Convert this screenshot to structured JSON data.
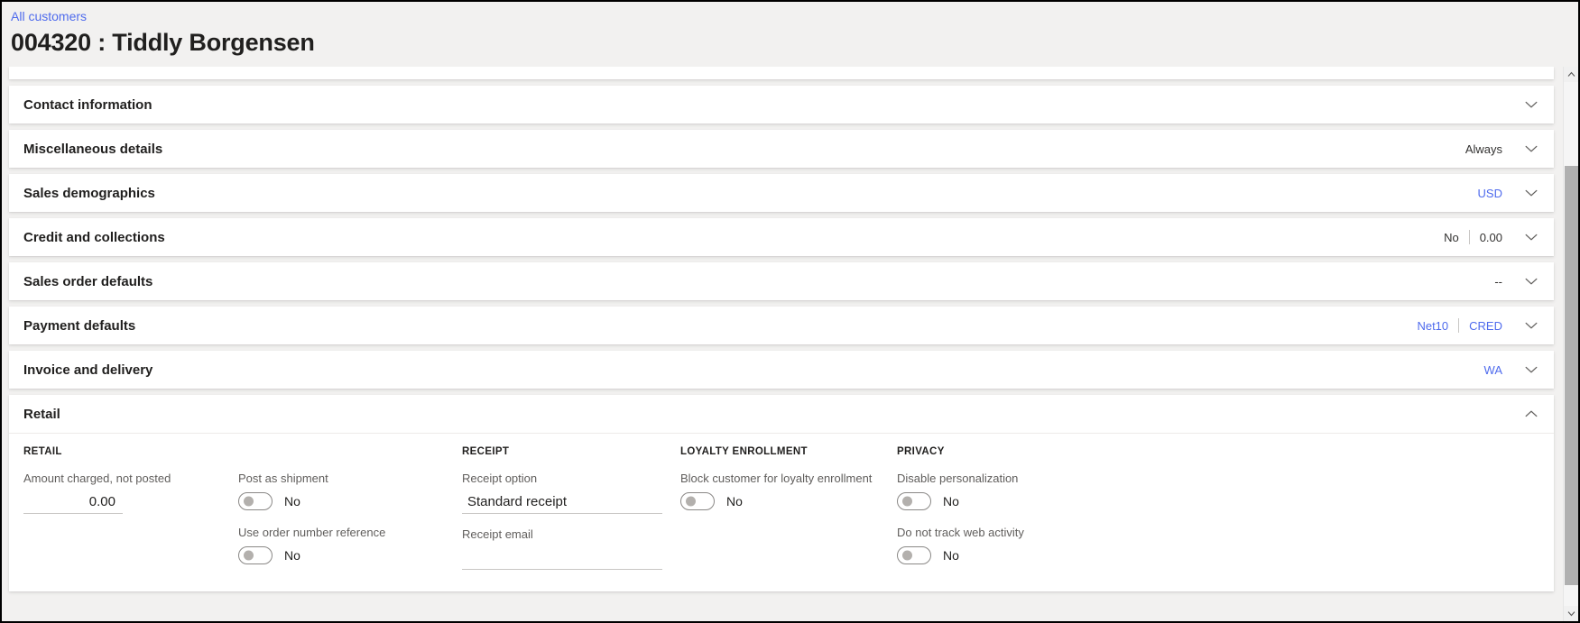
{
  "header": {
    "breadcrumb": "All customers",
    "title": "004320 : Tiddly Borgensen"
  },
  "sections": [
    {
      "title": "Contact information",
      "summary": [],
      "expanded": false
    },
    {
      "title": "Miscellaneous details",
      "summary": [
        {
          "text": "Always",
          "link": false
        }
      ],
      "expanded": false
    },
    {
      "title": "Sales demographics",
      "summary": [
        {
          "text": "USD",
          "link": true
        }
      ],
      "expanded": false
    },
    {
      "title": "Credit and collections",
      "summary": [
        {
          "text": "No",
          "link": false
        },
        {
          "text": "0.00",
          "link": false
        }
      ],
      "expanded": false
    },
    {
      "title": "Sales order defaults",
      "summary": [
        {
          "text": "--",
          "link": false
        }
      ],
      "expanded": false
    },
    {
      "title": "Payment defaults",
      "summary": [
        {
          "text": "Net10",
          "link": true
        },
        {
          "text": "CRED",
          "link": true
        }
      ],
      "expanded": false
    },
    {
      "title": "Invoice and delivery",
      "summary": [
        {
          "text": "WA",
          "link": true
        }
      ],
      "expanded": false
    },
    {
      "title": "Retail",
      "summary": [],
      "expanded": true
    }
  ],
  "retail": {
    "columns": [
      {
        "heading": "RETAIL",
        "fields": [
          {
            "type": "numeric",
            "label": "Amount charged, not posted",
            "value": "0.00",
            "placeholder": ""
          }
        ]
      },
      {
        "heading": "",
        "fields": [
          {
            "type": "toggle",
            "label": "Post as shipment",
            "value": "No"
          },
          {
            "type": "toggle",
            "label": "Use order number reference",
            "value": "No"
          }
        ]
      },
      {
        "heading": "RECEIPT",
        "fields": [
          {
            "type": "text",
            "label": "Receipt option",
            "value": "Standard receipt",
            "placeholder": ""
          },
          {
            "type": "text",
            "label": "Receipt email",
            "value": "",
            "placeholder": ""
          }
        ]
      },
      {
        "heading": "LOYALTY ENROLLMENT",
        "fields": [
          {
            "type": "toggle",
            "label": "Block customer for loyalty enrollment",
            "value": "No"
          }
        ]
      },
      {
        "heading": "PRIVACY",
        "fields": [
          {
            "type": "toggle",
            "label": "Disable personalization",
            "value": "No"
          },
          {
            "type": "toggle",
            "label": "Do not track web activity",
            "value": "No"
          }
        ]
      }
    ]
  },
  "scrollbar": {
    "up_arrow": "˄",
    "down_arrow": "˅",
    "thumb_top_pct": 16,
    "thumb_height_pct": 80
  },
  "colors": {
    "link": "#4f6bed",
    "page_bg": "#f2f1f0",
    "card_bg": "#ffffff",
    "text": "#201f1e",
    "label": "#605e5c"
  }
}
